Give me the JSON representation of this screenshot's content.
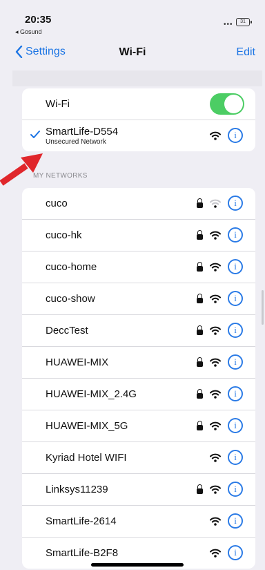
{
  "status": {
    "time": "20:35",
    "back_app": "◂ Gosund",
    "battery": "31"
  },
  "nav": {
    "back_label": "Settings",
    "title": "Wi-Fi",
    "edit_label": "Edit"
  },
  "wifi_card": {
    "wifi_label": "Wi-Fi",
    "wifi_on": true,
    "connected_name": "SmartLife-D554",
    "connected_sub": "Unsecured Network"
  },
  "section": {
    "my_networks": "MY NETWORKS"
  },
  "networks": [
    {
      "name": "cuco",
      "locked": true,
      "strength": "low"
    },
    {
      "name": "cuco-hk",
      "locked": true,
      "strength": "full"
    },
    {
      "name": "cuco-home",
      "locked": true,
      "strength": "full"
    },
    {
      "name": "cuco-show",
      "locked": true,
      "strength": "full"
    },
    {
      "name": "DeccTest",
      "locked": true,
      "strength": "full"
    },
    {
      "name": "HUAWEI-MIX",
      "locked": true,
      "strength": "full"
    },
    {
      "name": "HUAWEI-MIX_2.4G",
      "locked": true,
      "strength": "full"
    },
    {
      "name": "HUAWEI-MIX_5G",
      "locked": true,
      "strength": "full"
    },
    {
      "name": "Kyriad Hotel WIFI",
      "locked": false,
      "strength": "full"
    },
    {
      "name": "Linksys11239",
      "locked": true,
      "strength": "full"
    },
    {
      "name": "SmartLife-2614",
      "locked": false,
      "strength": "full"
    },
    {
      "name": "SmartLife-B2F8",
      "locked": false,
      "strength": "full"
    }
  ],
  "colors": {
    "accent": "#1b74e4",
    "toggle_on": "#4ccd64",
    "arrow": "#e0262b"
  }
}
